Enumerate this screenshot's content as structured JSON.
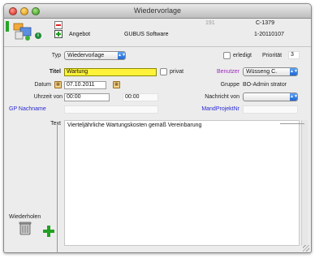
{
  "window": {
    "title": "Wiedervorlage"
  },
  "header": {
    "id_small": "191",
    "number": "C-1379",
    "type_label": "Angebot",
    "company": "GUBUS Software",
    "doc_id": "1-20110107"
  },
  "form": {
    "typ": {
      "label": "Typ",
      "value": "Wiedervorlage"
    },
    "erledigt": {
      "label": "erledigt",
      "checked": false
    },
    "prioritaet": {
      "label": "Priorität",
      "value": "3"
    },
    "titel": {
      "label": "Titel",
      "value": "Wartung"
    },
    "privat": {
      "label": "privat",
      "checked": false
    },
    "benutzer": {
      "label": "Benutzer",
      "value": "Wüsseng C."
    },
    "datum": {
      "label": "Datum",
      "value": "07.10.2011"
    },
    "gruppe": {
      "label": "Gruppe",
      "value": "BO-Admin strator"
    },
    "uhrzeit": {
      "label": "Uhrzeit von",
      "from": "00:00",
      "to": "00:00"
    },
    "nachricht": {
      "label": "Nachricht von",
      "value": ""
    },
    "gp_nachname": {
      "label": "GP Nachname",
      "value": ""
    },
    "mandprojektnr": {
      "label": "MandProjektNr",
      "value": ""
    },
    "text": {
      "label": "Text",
      "value": "Vierteljährliche Wartungskosten gemäß Vereinbarung"
    }
  },
  "footer": {
    "wiederholen_label": "Wiederholen"
  },
  "colors": {
    "required_field": "#fff23a",
    "blue_label": "#2a2ad2",
    "purple_label": "#9a2ab8",
    "accent_green": "#22a122"
  },
  "icons": [
    "app-logo-icon",
    "info-icon",
    "minus-icon",
    "plus-icon",
    "calendar-icon",
    "trash-icon",
    "add-icon"
  ]
}
